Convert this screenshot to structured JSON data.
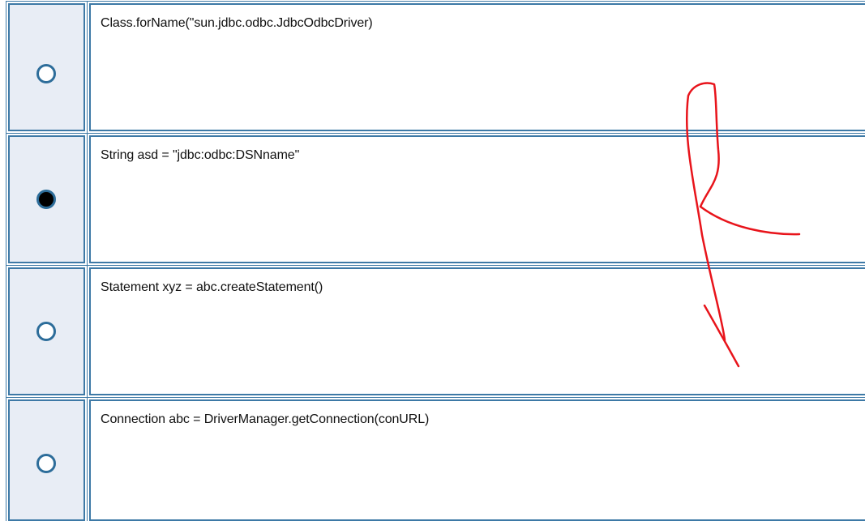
{
  "options": [
    {
      "text": "Class.forName(\"sun.jdbc.odbc.JdbcOdbcDriver)",
      "selected": false
    },
    {
      "text": "String asd = \"jdbc:odbc:DSNname\"",
      "selected": true
    },
    {
      "text": "Statement xyz = abc.createStatement()",
      "selected": false
    },
    {
      "text": "Connection abc = DriverManager.getConnection(conURL)",
      "selected": false
    }
  ],
  "annotation": {
    "color": "#e8141b",
    "shape": "handwritten-arrow"
  },
  "colors": {
    "border": "#3d79a6",
    "radio_cell_bg": "#e8edf5",
    "radio_border": "#2d6d9a"
  }
}
